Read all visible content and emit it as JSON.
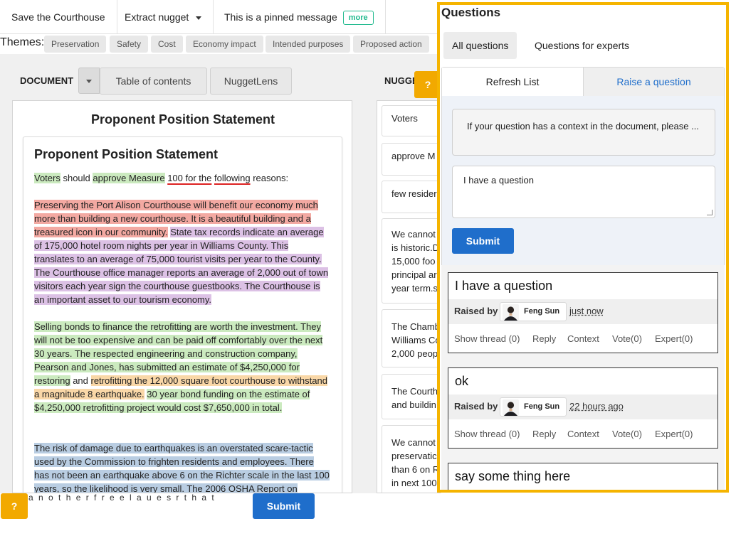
{
  "topbar": {
    "title": "Save the Courthouse",
    "extract": "Extract nugget",
    "pinned": "This is a pinned message",
    "more": "more"
  },
  "themes": {
    "label": "Themes:",
    "chips": [
      "Preservation",
      "Safety",
      "Cost",
      "Economy impact",
      "Intended purposes",
      "Proposed action"
    ]
  },
  "document": {
    "label": "DOCUMENT",
    "tabs": [
      "Table of contents",
      "NuggetLens"
    ],
    "title": "Proponent Position Statement",
    "inner_title": "Proponent Position Statement",
    "intro": {
      "voters": "Voters",
      "should": " should ",
      "approve": "approve Measure",
      "space": " ",
      "u1": "100 for the",
      "space2": " ",
      "u2": "following",
      "reasons": " reasons:"
    },
    "p1": {
      "red": "Preserving the Port Alison Courthouse will benefit our economy much more than building a new courthouse. It is a beautiful building and a treasured icon in our community.",
      "purple": "State tax records indicate an average of 175,000 hotel room nights per year in Williams County. This translates to an average of 75,000 tourist visits per year to the County. The Courthouse office manager reports an average of 2,000 out of town visitors each year sign the courthouse guestbooks. The Courthouse is an important asset to our tourism economy."
    },
    "p2": {
      "green1": "Selling bonds to finance the retrofitting are worth the investment. They will not be too expensive and can be paid off comfortably over the next 30 years. The respected engineering and construction company, Pearson and Jones, has submitted an estimate of $4,250,000 for restoring",
      "and": " and ",
      "orange": "retrofitting the 12,000 square foot courthouse to withstand a magnitude 8 earthquake.",
      "green2": "30 year bond funding on the estimate of $4,250,000 retrofitting project would cost $7,650,000 in total."
    },
    "p3": {
      "blue": "The risk of damage due to earthquakes is an overstated scare-tactic used by the Commission to frighten residents and employees. There has not been an earthquake above 6 on the Richter scale in the last 100 years, so the likelihood is very small. The 2006 OSHA Report on"
    }
  },
  "nuggets": {
    "label": "NUGGE",
    "cards": [
      [
        "Voters"
      ],
      [
        "approve M"
      ],
      [
        "few resider"
      ],
      [
        "We cannot",
        "is historic.D",
        "15,000 foo",
        "principal ar",
        "year term.s"
      ],
      [
        "The Chamb",
        "Williams Co",
        "2,000 peop"
      ],
      [
        "The Courth",
        "and buildin"
      ],
      [
        "We cannot",
        "preservatic",
        "than 6 on R",
        "in next 100"
      ]
    ]
  },
  "help": "?",
  "bottom": {
    "garbled": "a n o t h e r f r e e l a u e s r t h a t",
    "submit": "Submit"
  },
  "questions": {
    "title": "Questions",
    "tabs": [
      "All questions",
      "Questions for experts"
    ],
    "refresh": "Refresh List",
    "raise": "Raise a question",
    "context_hint": "If your question has a context in the document, please ...",
    "input_value": "I have a question",
    "submit": "Submit",
    "list": [
      {
        "title": "I have a question",
        "raised_by": "Raised by",
        "user": "Feng Sun",
        "time": "just now",
        "show_thread": "Show thread (0)",
        "reply": "Reply",
        "context": "Context",
        "vote": "Vote(0)",
        "expert": "Expert(0)"
      },
      {
        "title": "ok",
        "raised_by": "Raised by",
        "user": "Feng Sun",
        "time": "22 hours ago",
        "show_thread": "Show thread (0)",
        "reply": "Reply",
        "context": "Context",
        "vote": "Vote(0)",
        "expert": "Expert(0)"
      },
      {
        "title": "say some thing here"
      }
    ]
  },
  "colors": {
    "accent": "#f5b400",
    "primary": "#1f6ecb",
    "badge": "#21ba8e",
    "green_hl": "#cbeabf",
    "red_hl": "#f3a9a2",
    "purple_hl": "#dcc1e5",
    "orange_hl": "#f9d7a7",
    "blue_hl": "#b9cde2"
  }
}
